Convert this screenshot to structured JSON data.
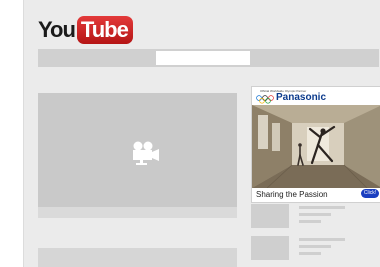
{
  "logo": {
    "you": "You",
    "tube": "Tube"
  },
  "search": {
    "value": ""
  },
  "video": {
    "icon": "video-camera-icon"
  },
  "ad": {
    "tagline": "Official Worldwide Olympic Partner",
    "brand": "Panasonic",
    "caption": "Sharing the Passion",
    "cta": "Click!"
  },
  "colors": {
    "page_bg": "#ebebeb",
    "logo_red": "#cc1f1f",
    "placeholder_gray": "#c9c9c9",
    "ad_brand_blue": "#0b3a8c",
    "cta_blue": "#1a3ec0"
  }
}
